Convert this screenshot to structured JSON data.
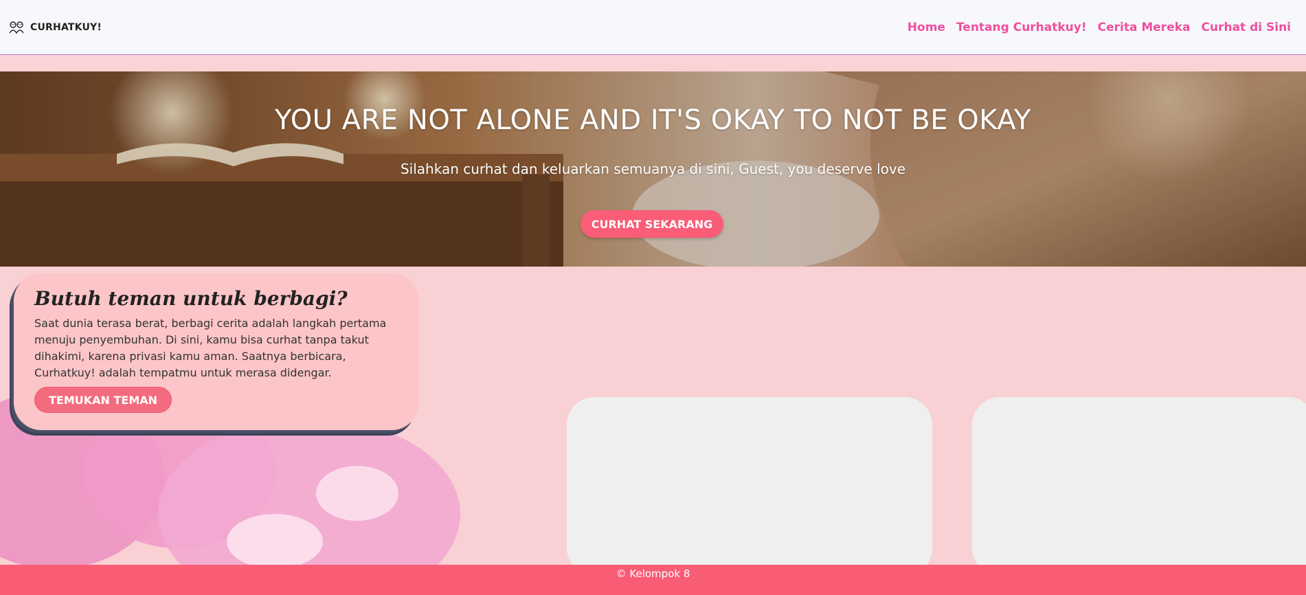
{
  "nav": {
    "brand": "CURHATKUY!",
    "links": [
      "Home",
      "Tentang Curhatkuy!",
      "Cerita Mereka",
      "Curhat di Sini"
    ]
  },
  "hero": {
    "title": "YOU ARE NOT ALONE AND IT'S OKAY TO NOT BE OKAY",
    "subtitle": "Silahkan curhat dan keluarkan semuanya di sini, Guest, you deserve love",
    "button": "CURHAT SEKARANG"
  },
  "info_card": {
    "title": "Butuh teman untuk berbagi?",
    "body": "Saat dunia terasa berat, berbagi cerita adalah langkah pertama menuju penyembuhan. Di sini, kamu bisa curhat tanpa takut dihakimi, karena privasi kamu aman. Saatnya berbicara, Curhatkuy! adalah tempatmu untuk merasa didengar.",
    "button": "TEMUKAN TEMAN"
  },
  "footer": {
    "text": "© Kelompok 8"
  },
  "colors": {
    "nav_link": "#ef4fa0",
    "accent_button": "#f95d77",
    "page_background": "#fad3d6",
    "card_background": "#fcc5c7",
    "footer_background": "#f95d75"
  },
  "icons": {
    "brand": "friends-logo-icon"
  }
}
